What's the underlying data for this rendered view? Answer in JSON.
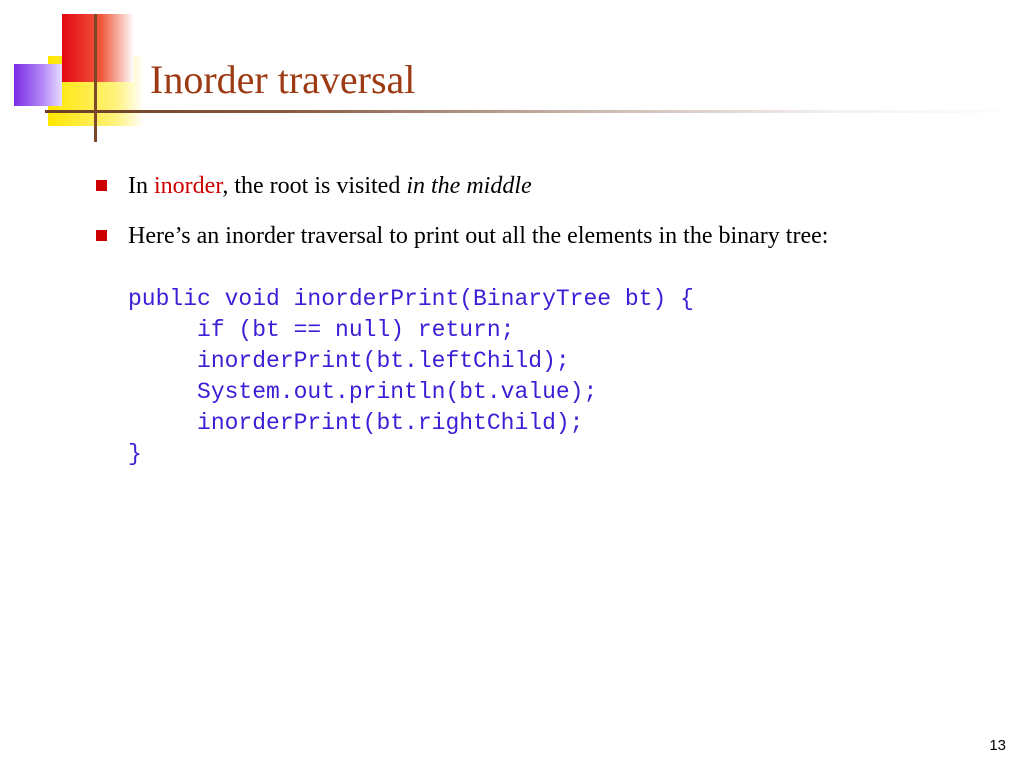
{
  "title": "Inorder traversal",
  "bullets": {
    "b1": {
      "pre": "In ",
      "key": "inorder",
      "mid": ", the root is visited ",
      "em": "in the middle"
    },
    "b2": "Here’s an inorder traversal to print out all the elements in the binary tree:"
  },
  "code": "public void inorderPrint(BinaryTree bt) {\n     if (bt == null) return;\n     inorderPrint(bt.leftChild);\n     System.out.println(bt.value);\n     inorderPrint(bt.rightChild);\n}",
  "page_number": "13"
}
